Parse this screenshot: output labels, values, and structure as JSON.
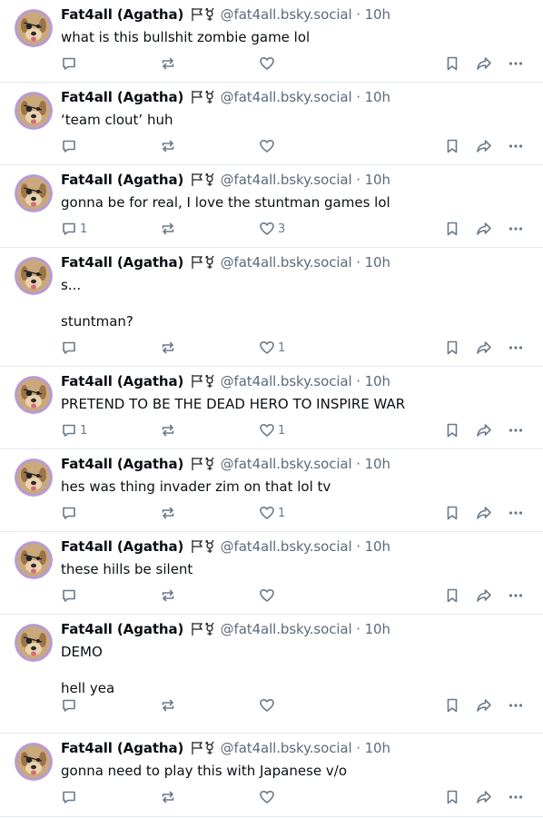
{
  "author": {
    "name": "Fat4all (Agatha)",
    "handle": "@fat4all.bsky.social",
    "separator": "·"
  },
  "colors": {
    "text": "#0b0f14",
    "muted": "#5b6b7b",
    "icon": "#6a7a8a",
    "divider": "#e4e8ec"
  },
  "icons": {
    "reply": "speech-bubble-icon",
    "repost": "repost-arrows-icon",
    "like": "heart-icon",
    "save": "bookmark-icon",
    "share": "share-arrow-icon",
    "more": "ellipsis-icon",
    "badges": "flag-and-symbol-icon"
  },
  "posts": [
    {
      "time": "10h",
      "lines": [
        "what is this bullshit zombie game lol"
      ],
      "replies": "",
      "likes": ""
    },
    {
      "time": "10h",
      "lines": [
        "‘team clout’ huh"
      ],
      "replies": "",
      "likes": ""
    },
    {
      "time": "10h",
      "lines": [
        "gonna be for real, I love the stuntman games lol"
      ],
      "replies": "1",
      "likes": "3"
    },
    {
      "time": "10h",
      "lines": [
        "s...",
        "stuntman?"
      ],
      "replies": "",
      "likes": "1"
    },
    {
      "time": "10h",
      "lines": [
        "PRETEND TO BE THE DEAD HERO TO INSPIRE WAR"
      ],
      "replies": "1",
      "likes": "1"
    },
    {
      "time": "10h",
      "lines": [
        "hes was thing invader zim on that lol tv"
      ],
      "replies": "",
      "likes": "1"
    },
    {
      "time": "10h",
      "lines": [
        "these hills be silent"
      ],
      "replies": "",
      "likes": ""
    },
    {
      "time": "10h",
      "lines": [
        "DEMO",
        "hell yea"
      ],
      "replies": "",
      "likes": ""
    },
    {
      "time": "10h",
      "lines": [
        "gonna need to play this with Japanese v/o"
      ],
      "replies": "",
      "likes": ""
    }
  ]
}
